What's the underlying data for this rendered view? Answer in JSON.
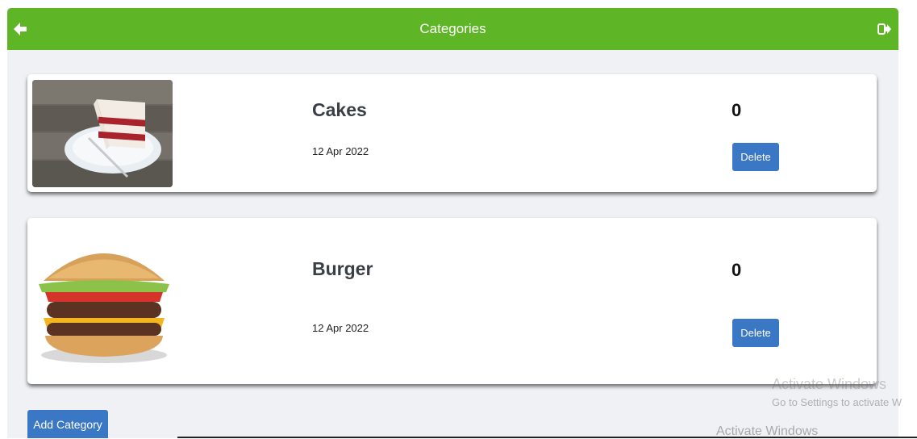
{
  "header": {
    "title": "Categories",
    "back_icon": "arrow-left-icon",
    "logout_icon": "sign-out-icon",
    "color": "#5eb526"
  },
  "categories": [
    {
      "name": "Cakes",
      "date": "12 Apr 2022",
      "count": "0",
      "delete_label": "Delete",
      "image": "cake-slice"
    },
    {
      "name": "Burger",
      "date": "12 Apr 2022",
      "count": "0",
      "delete_label": "Delete",
      "image": "cheeseburger"
    }
  ],
  "add_button": {
    "label": "Add Category"
  },
  "watermark": {
    "line1": "Activate Windows",
    "line2": "Go to Settings to activate W",
    "line3": "Activate Windows"
  },
  "colors": {
    "primary_button": "#3a77c4",
    "background": "#eff1f5"
  }
}
